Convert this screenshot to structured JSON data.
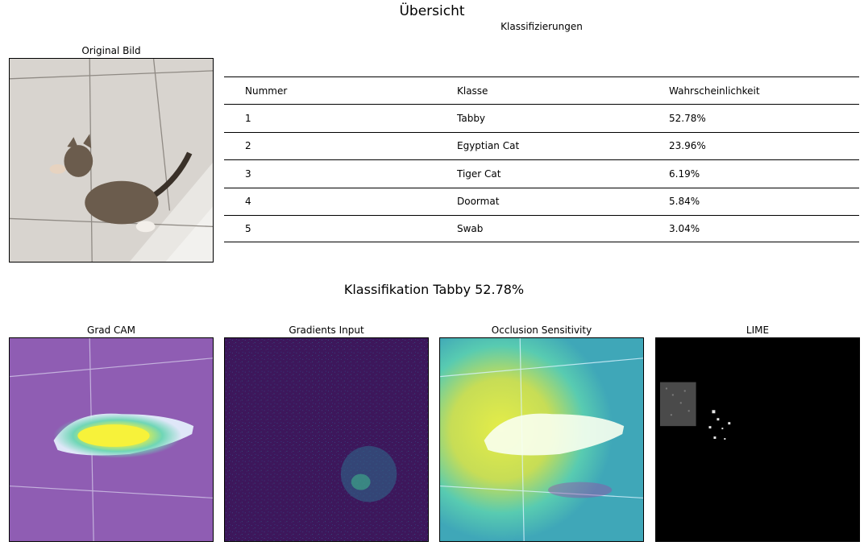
{
  "header": {
    "title": "Übersicht",
    "table_title": "Klassifizierungen"
  },
  "original": {
    "title": "Original Bild"
  },
  "table": {
    "headers": [
      "Nummer",
      "Klasse",
      "Wahrscheinlichkeit"
    ],
    "rows": [
      [
        "1",
        "Tabby",
        "52.78%"
      ],
      [
        "2",
        "Egyptian Cat",
        "23.96%"
      ],
      [
        "3",
        "Tiger Cat",
        "6.19%"
      ],
      [
        "4",
        "Doormat",
        "5.84%"
      ],
      [
        "5",
        "Swab",
        "3.04%"
      ]
    ]
  },
  "section": {
    "title": "Klassifikation Tabby 52.78%"
  },
  "maps": [
    {
      "title": "Grad CAM"
    },
    {
      "title": "Gradients Input"
    },
    {
      "title": "Occlusion Sensitivity"
    },
    {
      "title": "LIME"
    }
  ]
}
